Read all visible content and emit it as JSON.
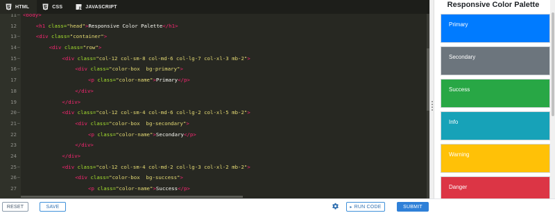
{
  "tabs": [
    {
      "label": "HTML",
      "icon": "html5-icon",
      "active": true
    },
    {
      "label": "CSS",
      "icon": "css3-icon",
      "active": false
    },
    {
      "label": "JAVASCRIPT",
      "icon": "js-icon",
      "active": false
    }
  ],
  "code": {
    "lines": [
      {
        "n": "11",
        "fold": true,
        "indent": 0,
        "tokens": [
          {
            "t": "tag",
            "v": "<body>"
          }
        ]
      },
      {
        "n": "12",
        "fold": false,
        "indent": 2,
        "tokens": [
          {
            "t": "tag",
            "v": "<h1"
          },
          {
            "t": "attr",
            "v": " class="
          },
          {
            "t": "str",
            "v": "\"head\""
          },
          {
            "t": "tag",
            "v": ">"
          },
          {
            "t": "txt",
            "v": "Responsive Color Palette"
          },
          {
            "t": "tag",
            "v": "</h1>"
          }
        ]
      },
      {
        "n": "13",
        "fold": true,
        "indent": 2,
        "tokens": [
          {
            "t": "tag",
            "v": "<div"
          },
          {
            "t": "attr",
            "v": " class="
          },
          {
            "t": "str",
            "v": "\"container\""
          },
          {
            "t": "tag",
            "v": ">"
          }
        ]
      },
      {
        "n": "14",
        "fold": true,
        "indent": 4,
        "tokens": [
          {
            "t": "tag",
            "v": "<div"
          },
          {
            "t": "attr",
            "v": " class="
          },
          {
            "t": "str",
            "v": "\"row\""
          },
          {
            "t": "tag",
            "v": ">"
          }
        ]
      },
      {
        "n": "15",
        "fold": true,
        "indent": 6,
        "tokens": [
          {
            "t": "tag",
            "v": "<div"
          },
          {
            "t": "attr",
            "v": " class="
          },
          {
            "t": "str",
            "v": "\"col-12 col-sm-8 col-md-6 col-lg-7 col-xl-3 mb-2\""
          },
          {
            "t": "tag",
            "v": ">"
          }
        ]
      },
      {
        "n": "16",
        "fold": true,
        "indent": 8,
        "tokens": [
          {
            "t": "tag",
            "v": "<div"
          },
          {
            "t": "attr",
            "v": " class="
          },
          {
            "t": "str",
            "v": "\"color-box  bg-primary\""
          },
          {
            "t": "tag",
            "v": ">"
          }
        ]
      },
      {
        "n": "17",
        "fold": false,
        "indent": 10,
        "tokens": [
          {
            "t": "tag",
            "v": "<p"
          },
          {
            "t": "attr",
            "v": " class="
          },
          {
            "t": "str",
            "v": "\"color-name\""
          },
          {
            "t": "tag",
            "v": ">"
          },
          {
            "t": "txt",
            "v": "Primary"
          },
          {
            "t": "tag",
            "v": "</p>"
          }
        ]
      },
      {
        "n": "18",
        "fold": false,
        "indent": 8,
        "tokens": [
          {
            "t": "tag",
            "v": "</div>"
          }
        ]
      },
      {
        "n": "19",
        "fold": false,
        "indent": 6,
        "tokens": [
          {
            "t": "tag",
            "v": "</div>"
          }
        ]
      },
      {
        "n": "20",
        "fold": true,
        "indent": 6,
        "tokens": [
          {
            "t": "tag",
            "v": "<div"
          },
          {
            "t": "attr",
            "v": " class="
          },
          {
            "t": "str",
            "v": "\"col-12 col-sm-4 col-md-6 col-lg-2 col-xl-5 mb-2\""
          },
          {
            "t": "tag",
            "v": ">"
          }
        ]
      },
      {
        "n": "21",
        "fold": true,
        "indent": 8,
        "tokens": [
          {
            "t": "tag",
            "v": "<div"
          },
          {
            "t": "attr",
            "v": " class="
          },
          {
            "t": "str",
            "v": "\"color-box  bg-secondary\""
          },
          {
            "t": "tag",
            "v": ">"
          }
        ]
      },
      {
        "n": "22",
        "fold": false,
        "indent": 10,
        "tokens": [
          {
            "t": "tag",
            "v": "<p"
          },
          {
            "t": "attr",
            "v": " class="
          },
          {
            "t": "str",
            "v": "\"color-name\""
          },
          {
            "t": "tag",
            "v": ">"
          },
          {
            "t": "txt",
            "v": "Secondary"
          },
          {
            "t": "tag",
            "v": "</p>"
          }
        ]
      },
      {
        "n": "23",
        "fold": false,
        "indent": 8,
        "tokens": [
          {
            "t": "tag",
            "v": "</div>"
          }
        ]
      },
      {
        "n": "24",
        "fold": false,
        "indent": 6,
        "tokens": [
          {
            "t": "tag",
            "v": "</div>"
          }
        ]
      },
      {
        "n": "25",
        "fold": true,
        "indent": 6,
        "tokens": [
          {
            "t": "tag",
            "v": "<div"
          },
          {
            "t": "attr",
            "v": " class="
          },
          {
            "t": "str",
            "v": "\"col-12 col-sm-4 col-md-2 col-lg-3 col-xl-2 mb-2\""
          },
          {
            "t": "tag",
            "v": ">"
          }
        ]
      },
      {
        "n": "26",
        "fold": true,
        "indent": 8,
        "tokens": [
          {
            "t": "tag",
            "v": "<div"
          },
          {
            "t": "attr",
            "v": " class="
          },
          {
            "t": "str",
            "v": "\"color-box  bg-success\""
          },
          {
            "t": "tag",
            "v": ">"
          }
        ]
      },
      {
        "n": "27",
        "fold": false,
        "indent": 10,
        "tokens": [
          {
            "t": "tag",
            "v": "<p"
          },
          {
            "t": "attr",
            "v": " class="
          },
          {
            "t": "str",
            "v": "\"color-name\""
          },
          {
            "t": "tag",
            "v": ">"
          },
          {
            "t": "txt",
            "v": "Success"
          },
          {
            "t": "tag",
            "v": "</p>"
          }
        ]
      }
    ]
  },
  "preview": {
    "title": "Responsive Color Palette",
    "boxes": [
      {
        "label": "Primary",
        "color": "#007bff"
      },
      {
        "label": "Secondary",
        "color": "#6c757d"
      },
      {
        "label": "Success",
        "color": "#28a745"
      },
      {
        "label": "Info",
        "color": "#17a2b8"
      },
      {
        "label": "Warning",
        "color": "#ffc107"
      },
      {
        "label": "Danger",
        "color": "#dc3545"
      }
    ]
  },
  "footer": {
    "reset_label": "RESET",
    "save_label": "SAVE",
    "run_label": "RUN CODE",
    "submit_label": "SUBMIT",
    "settings_icon": "gear-icon"
  }
}
